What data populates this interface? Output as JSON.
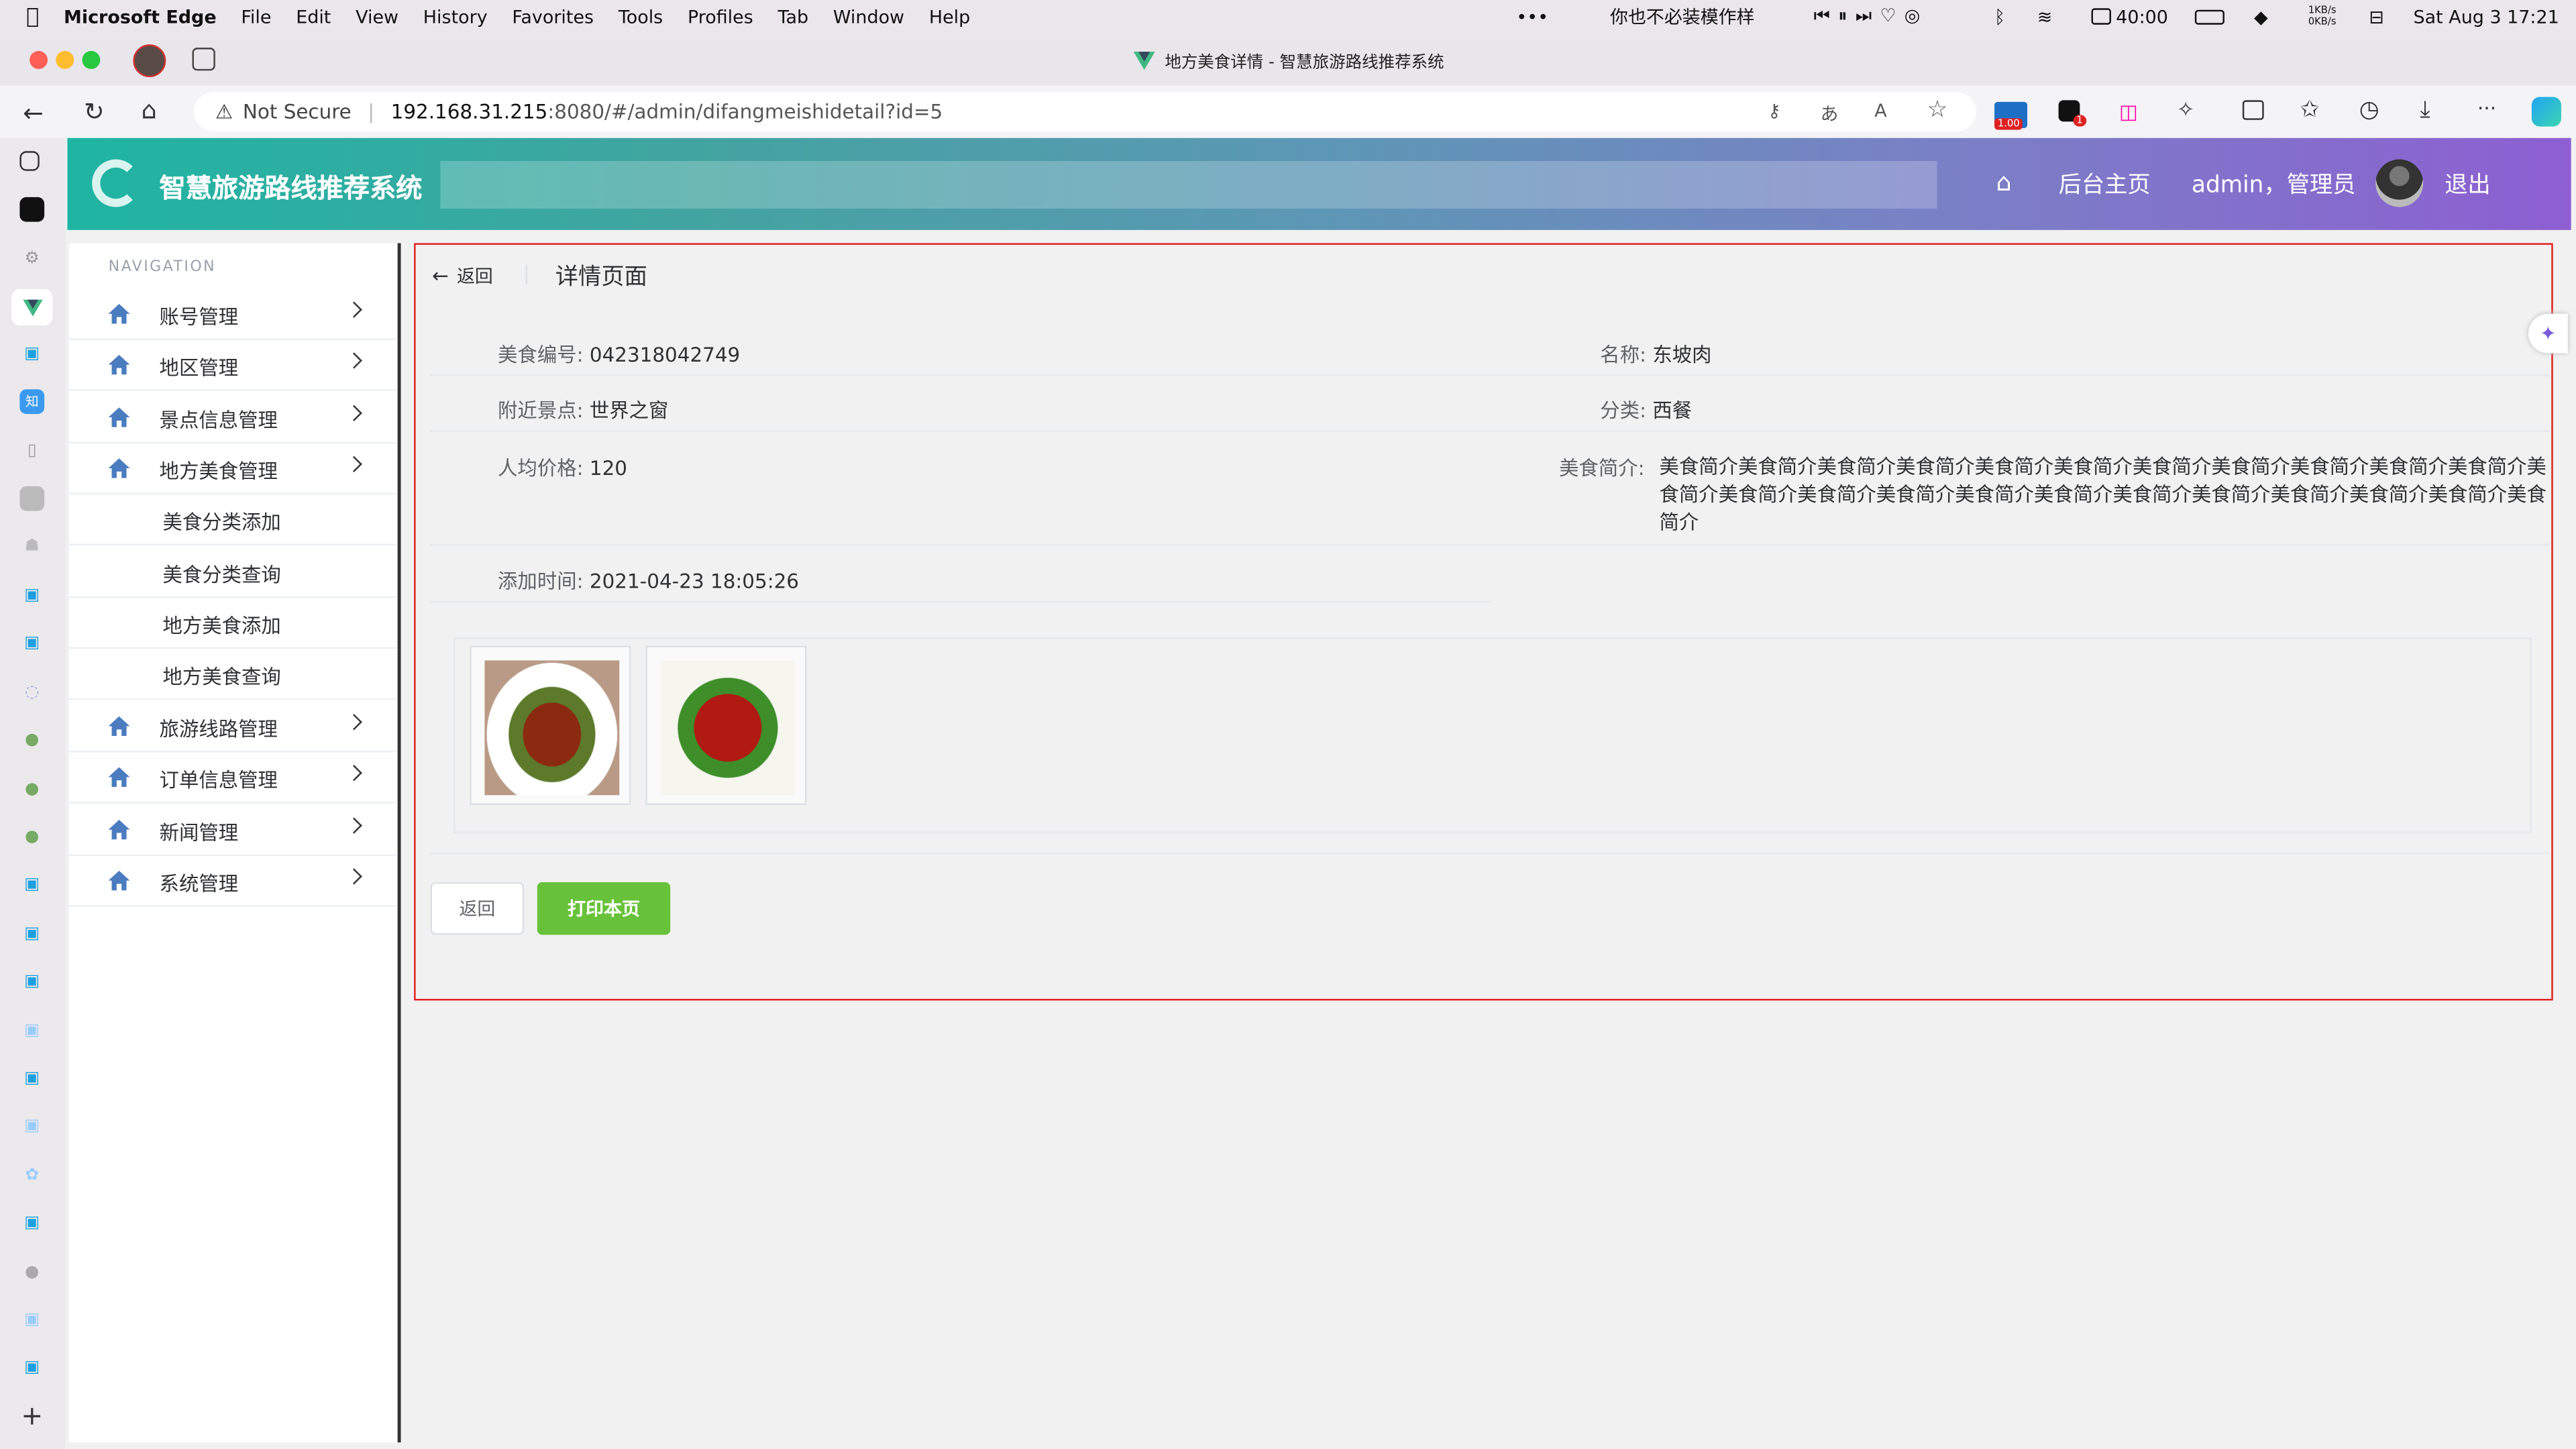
{
  "menubar": {
    "app": "Microsoft Edge",
    "items": [
      "File",
      "Edit",
      "View",
      "History",
      "Favorites",
      "Tools",
      "Profiles",
      "Tab",
      "Window",
      "Help"
    ],
    "song": "你也不必装模作样",
    "battery": "40:00",
    "net_up": "1KB/s",
    "net_down": "0KB/s",
    "datetime": "Sat Aug 3  17:21"
  },
  "browser": {
    "tab_title": "地方美食详情 - 智慧旅游路线推荐系统",
    "not_secure": "Not Secure",
    "url_host": "192.168.31.215",
    "url_rest": ":8080/#/admin/difangmeishidetail?id=5",
    "badge_value": "1.00",
    "badge_count": "1"
  },
  "header": {
    "system_name": "智慧旅游路线推荐系统",
    "home_label": "后台主页",
    "user_label": "admin，管理员",
    "logout_label": "退出"
  },
  "nav": {
    "heading": "NAVIGATION",
    "items": [
      {
        "label": "账号管理"
      },
      {
        "label": "地区管理"
      },
      {
        "label": "景点信息管理"
      },
      {
        "label": "地方美食管理"
      }
    ],
    "sub_items": [
      {
        "label": "美食分类添加"
      },
      {
        "label": "美食分类查询"
      },
      {
        "label": "地方美食添加"
      },
      {
        "label": "地方美食查询"
      }
    ],
    "items2": [
      {
        "label": "旅游线路管理"
      },
      {
        "label": "订单信息管理"
      },
      {
        "label": "新闻管理"
      },
      {
        "label": "系统管理"
      }
    ]
  },
  "page": {
    "back_label": "返回",
    "title": "详情页面",
    "fields": {
      "code_label": "美食编号:",
      "code_value": "042318042749",
      "name_label": "名称:",
      "name_value": "东坡肉",
      "spot_label": "附近景点:",
      "spot_value": "世界之窗",
      "category_label": "分类:",
      "category_value": "西餐",
      "price_label": "人均价格:",
      "price_value": "120",
      "intro_label": "美食简介:",
      "intro_value": "美食简介美食简介美食简介美食简介美食简介美食简介美食简介美食简介美食简介美食简介美食简介美食简介美食简介美食简介美食简介美食简介美食简介美食简介美食简介美食简介美食简介美食简介美食简介",
      "time_label": "添加时间:",
      "time_value": "2021-04-23 18:05:26"
    },
    "back_button": "返回",
    "print_button": "打印本页"
  },
  "colors": {
    "accent_green": "#67c23a",
    "panel_border": "#e02020",
    "nav_icon": "#4a7cbf"
  }
}
